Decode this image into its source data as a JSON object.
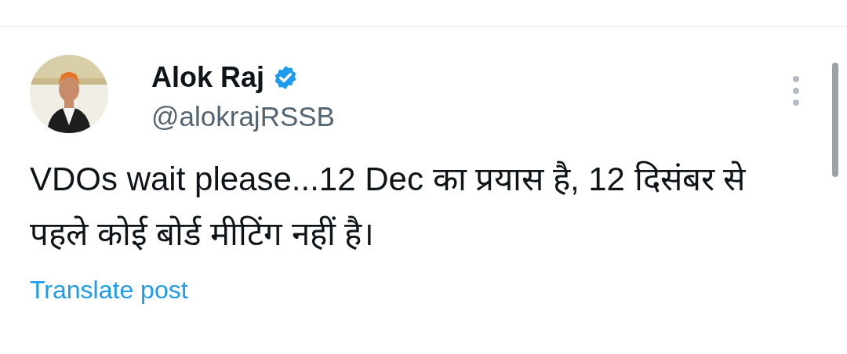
{
  "author": {
    "name": "Alok Raj",
    "verified": true,
    "handle": "@alokrajRSSB"
  },
  "post": {
    "text": "VDOs wait please...12 Dec का प्रयास है, 12 दिसंबर से पहले कोई बोर्ड मीटिंग नहीं है।"
  },
  "translate_link": "Translate post"
}
